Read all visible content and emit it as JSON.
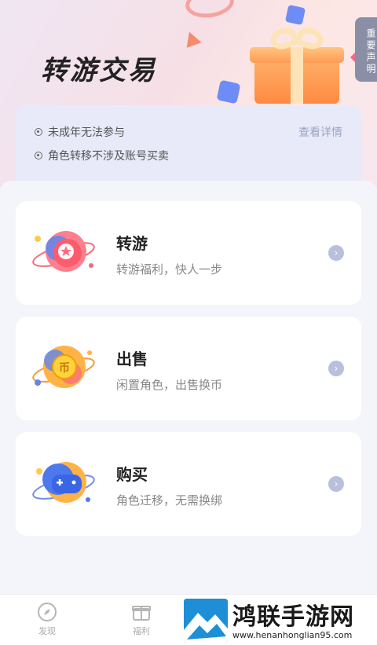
{
  "header": {
    "title": "转游交易",
    "notice_tab": "重要声明"
  },
  "notice": {
    "items": [
      "未成年无法参与",
      "角色转移不涉及账号买卖"
    ],
    "link": "查看详情"
  },
  "cards": [
    {
      "title": "转游",
      "subtitle": "转游福利，快人一步",
      "icon": "star-planet-icon"
    },
    {
      "title": "出售",
      "subtitle": "闲置角色，出售换币",
      "icon": "coin-planet-icon"
    },
    {
      "title": "购买",
      "subtitle": "角色迁移，无需换绑",
      "icon": "gamepad-planet-icon"
    }
  ],
  "nav": {
    "items": [
      {
        "label": "发现",
        "icon": "compass-icon"
      },
      {
        "label": "福利",
        "icon": "gift-box-icon"
      }
    ]
  },
  "watermark": {
    "name": "鸿联手游网",
    "url": "www.henanhonglian95.com"
  }
}
